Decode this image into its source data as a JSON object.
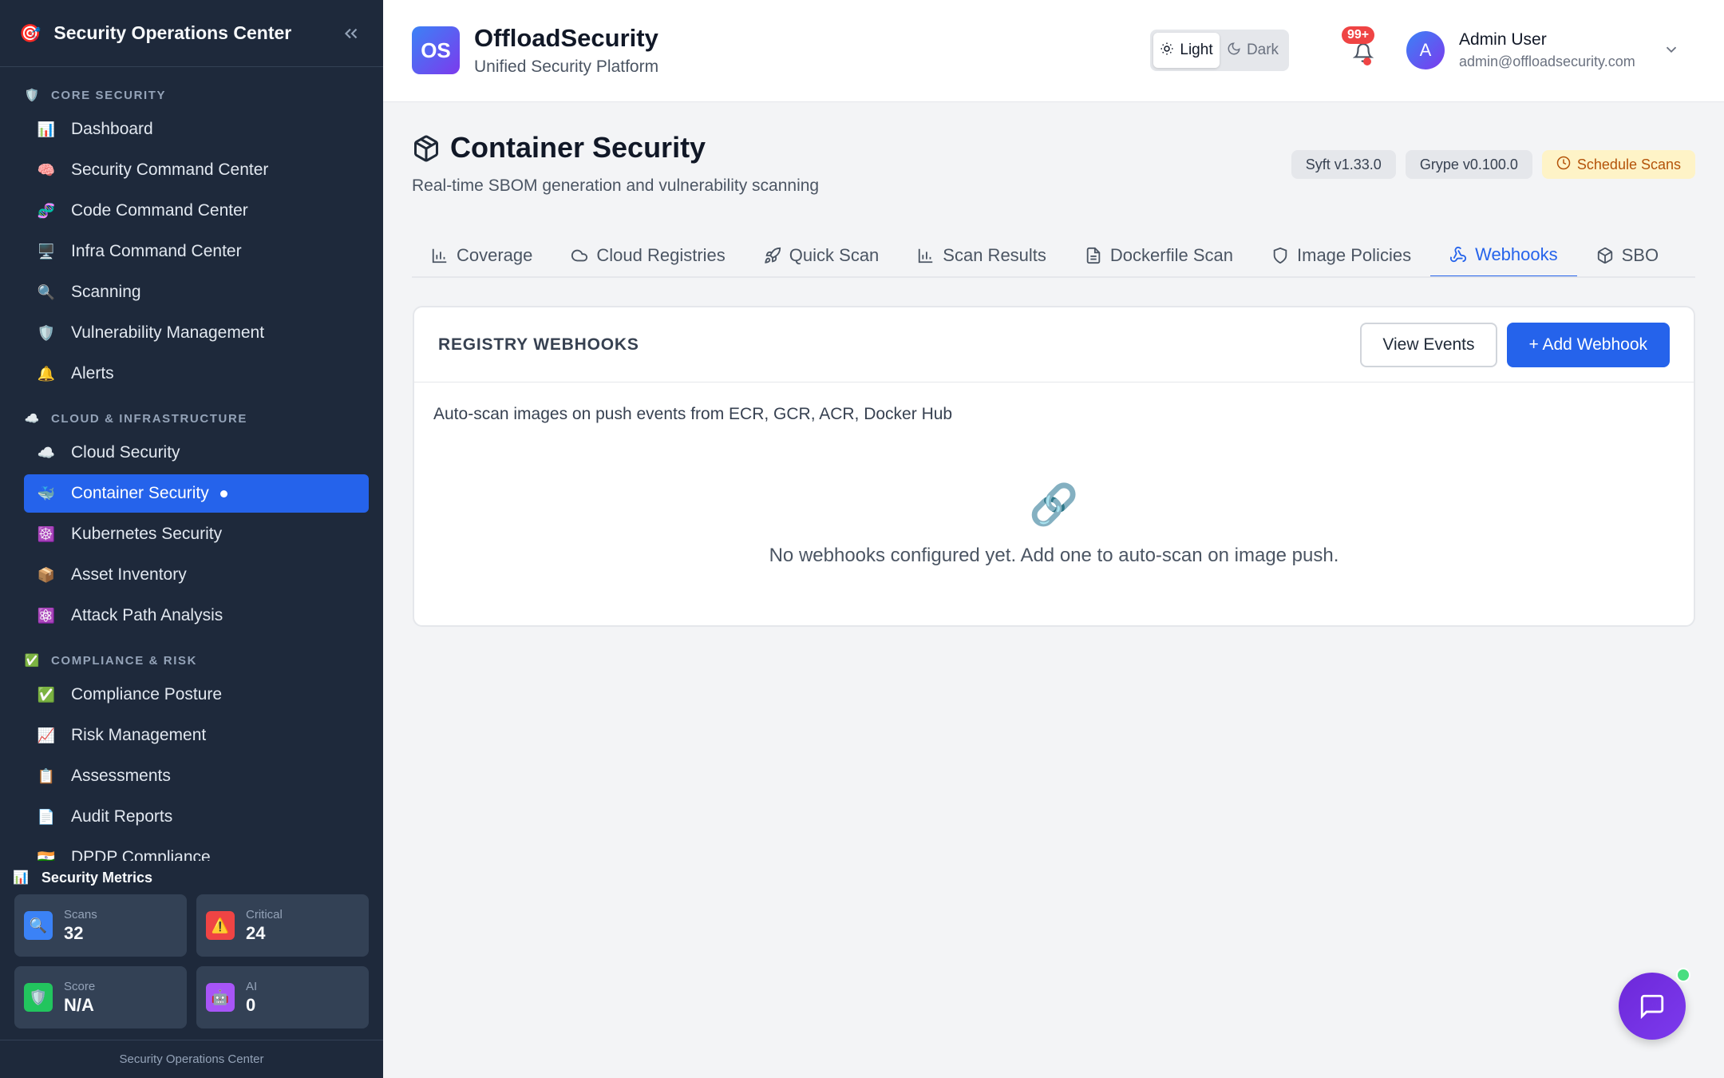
{
  "sidebar": {
    "title": "Security Operations Center",
    "sections": [
      {
        "label": "CORE SECURITY",
        "icon": "🛡️",
        "items": [
          {
            "label": "Dashboard",
            "icon": "📊"
          },
          {
            "label": "Security Command Center",
            "icon": "🧠"
          },
          {
            "label": "Code Command Center",
            "icon": "🧬"
          },
          {
            "label": "Infra Command Center",
            "icon": "🖥️"
          },
          {
            "label": "Scanning",
            "icon": "🔍"
          },
          {
            "label": "Vulnerability Management",
            "icon": "🛡️"
          },
          {
            "label": "Alerts",
            "icon": "🔔"
          }
        ]
      },
      {
        "label": "CLOUD & INFRASTRUCTURE",
        "icon": "☁️",
        "items": [
          {
            "label": "Cloud Security",
            "icon": "☁️"
          },
          {
            "label": "Container Security",
            "icon": "🐳"
          },
          {
            "label": "Kubernetes Security",
            "icon": "☸️"
          },
          {
            "label": "Asset Inventory",
            "icon": "📦"
          },
          {
            "label": "Attack Path Analysis",
            "icon": "⚛️"
          }
        ]
      },
      {
        "label": "COMPLIANCE & RISK",
        "icon": "✅",
        "items": [
          {
            "label": "Compliance Posture",
            "icon": "✅"
          },
          {
            "label": "Risk Management",
            "icon": "📈"
          },
          {
            "label": "Assessments",
            "icon": "📋"
          },
          {
            "label": "Audit Reports",
            "icon": "📄"
          },
          {
            "label": "DPDP Compliance",
            "icon": "🇮🇳"
          }
        ]
      }
    ],
    "metrics_title": "Security Metrics",
    "metrics": {
      "scans": {
        "label": "Scans",
        "value": "32"
      },
      "critical": {
        "label": "Critical",
        "value": "24"
      },
      "score": {
        "label": "Score",
        "value": "N/A"
      },
      "ai": {
        "label": "AI",
        "value": "0"
      }
    },
    "footer": "Security Operations Center"
  },
  "header": {
    "logo": "OS",
    "brand": "OffloadSecurity",
    "tagline": "Unified Security Platform",
    "theme_light": "Light",
    "theme_dark": "Dark",
    "notifications": "99+",
    "avatar": "A",
    "user_name": "Admin User",
    "user_email": "admin@offloadsecurity.com"
  },
  "page": {
    "title": "Container Security",
    "subtitle": "Real-time SBOM generation and vulnerability scanning",
    "badges": {
      "syft": "Syft v1.33.0",
      "grype": "Grype v0.100.0",
      "schedule": "Schedule Scans"
    },
    "tabs": [
      "Coverage",
      "Cloud Registries",
      "Quick Scan",
      "Scan Results",
      "Dockerfile Scan",
      "Image Policies",
      "Webhooks",
      "SBO"
    ],
    "card": {
      "title": "REGISTRY WEBHOOKS",
      "view_events": "View Events",
      "add_webhook": "+ Add Webhook",
      "description": "Auto-scan images on push events from ECR, GCR, ACR, Docker Hub",
      "empty_icon": "🔗",
      "empty_text": "No webhooks configured yet. Add one to auto-scan on image push."
    }
  },
  "colors": {
    "accent": "#2563eb",
    "sidebar_bg": "#1e293b",
    "schedule": "#b45309"
  }
}
